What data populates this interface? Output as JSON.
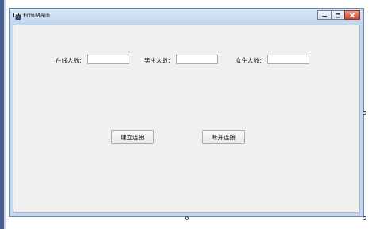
{
  "window": {
    "title": "FrmMain"
  },
  "form": {
    "online_label": "在线人数:",
    "online_value": "",
    "male_label": "男生人数:",
    "male_value": "",
    "female_label": "女生人数:",
    "female_value": "",
    "connect_button": "建立连接",
    "disconnect_button": "断开连接"
  },
  "colors": {
    "titlebar": "#c8dbef",
    "client_bg": "#f0f0f0",
    "close_button": "#c94a37"
  },
  "icons": {
    "app": "form-window-icon",
    "minimize": "minimize-icon",
    "maximize": "maximize-icon",
    "close": "close-icon"
  }
}
